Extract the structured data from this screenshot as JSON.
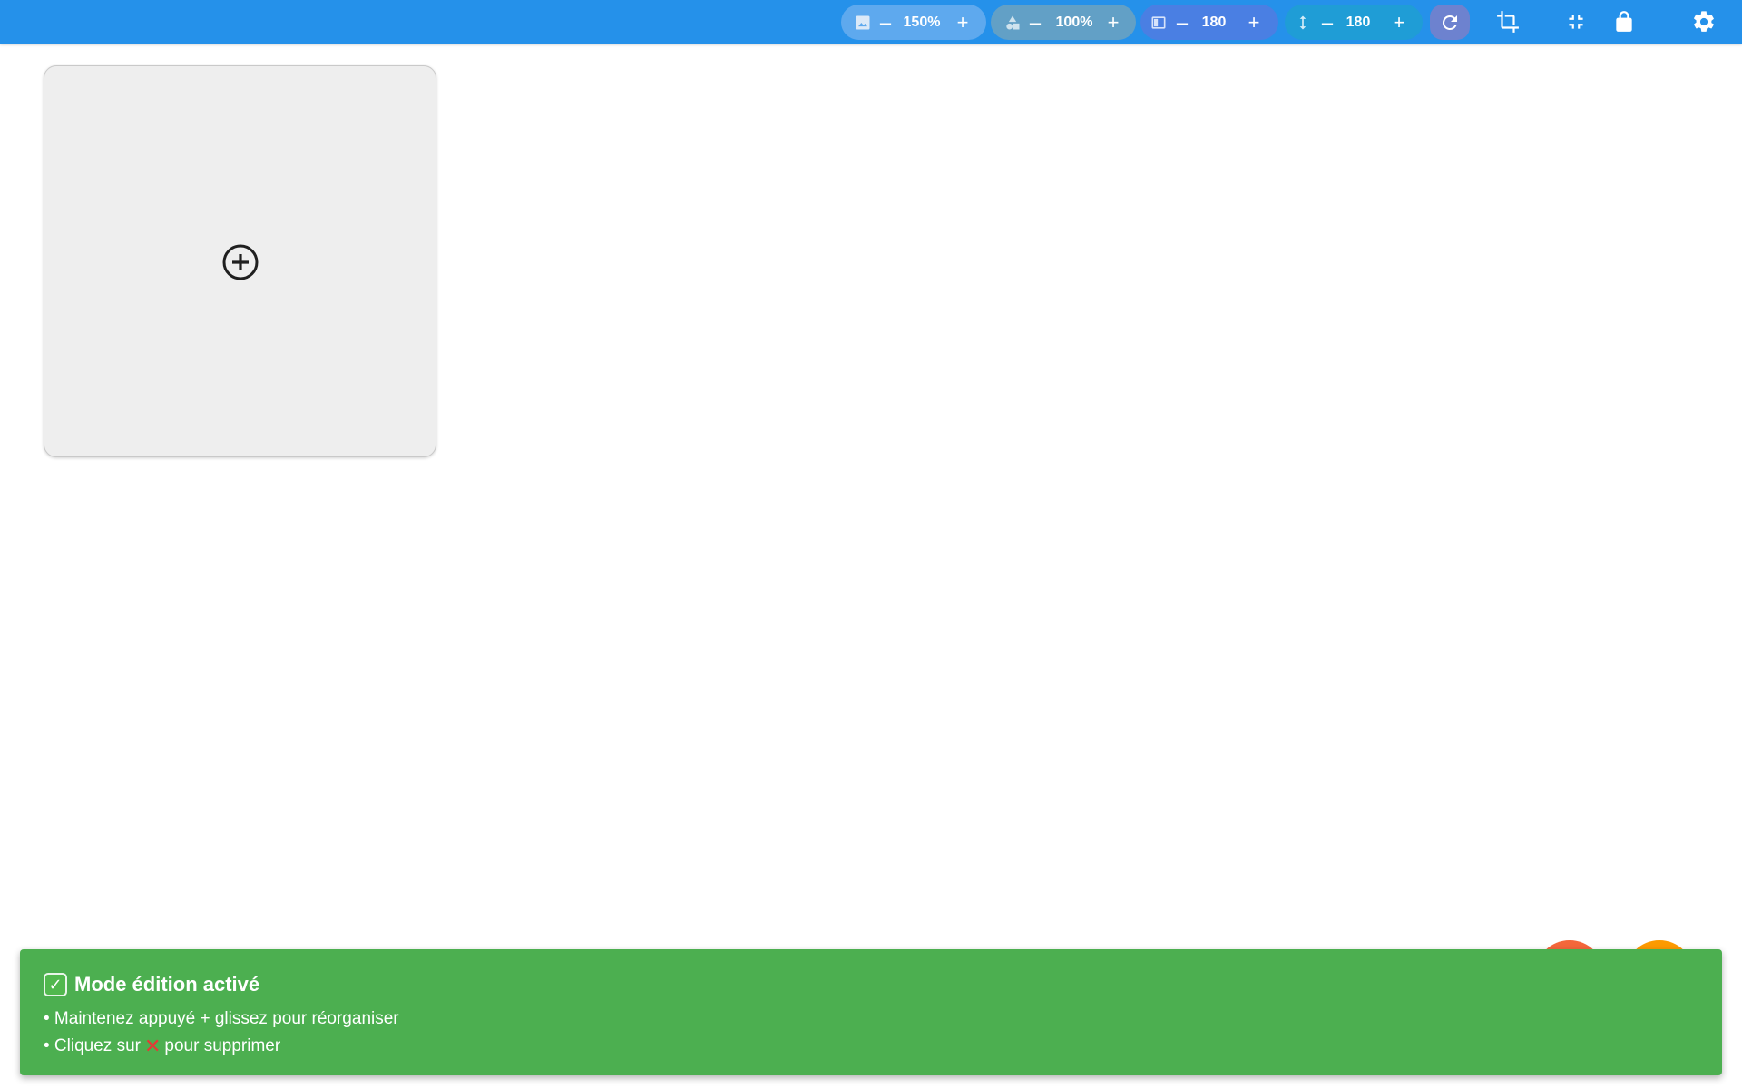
{
  "toolbar": {
    "image_zoom": {
      "icon": "image-icon",
      "value": "150%",
      "minus": "–",
      "plus": "+",
      "color": "#5ea9ee"
    },
    "shape_zoom": {
      "icon": "shapes-icon",
      "value": "100%",
      "minus": "–",
      "plus": "+",
      "color": "#62a0c6"
    },
    "width": {
      "icon": "column-width-icon",
      "value": "180",
      "minus": "–",
      "plus": "+",
      "color": "#4a7fe3"
    },
    "height": {
      "icon": "vertical-arrows-icon",
      "value": "180",
      "minus": "–",
      "plus": "+",
      "color": "#1f9dd6"
    },
    "tools": [
      "refresh-icon",
      "crop-icon",
      "fullscreen-exit-icon",
      "lock-icon",
      "gear-icon"
    ],
    "bar_color": "#2591ea",
    "refresh_bg": "#6d82cf"
  },
  "grid": {
    "add_card_icon": "add-circle-icon"
  },
  "fabs": [
    {
      "color": "#f4673b"
    },
    {
      "color": "#fd9a00"
    }
  ],
  "snackbar": {
    "check": "✓",
    "title": "Mode édition activé",
    "line1": "• Maintenez appuyé + glissez pour réorganiser",
    "line2_prefix": "• Cliquez sur",
    "line2_symbol": "✕",
    "line2_suffix": "pour supprimer",
    "color": "#4caf50"
  }
}
